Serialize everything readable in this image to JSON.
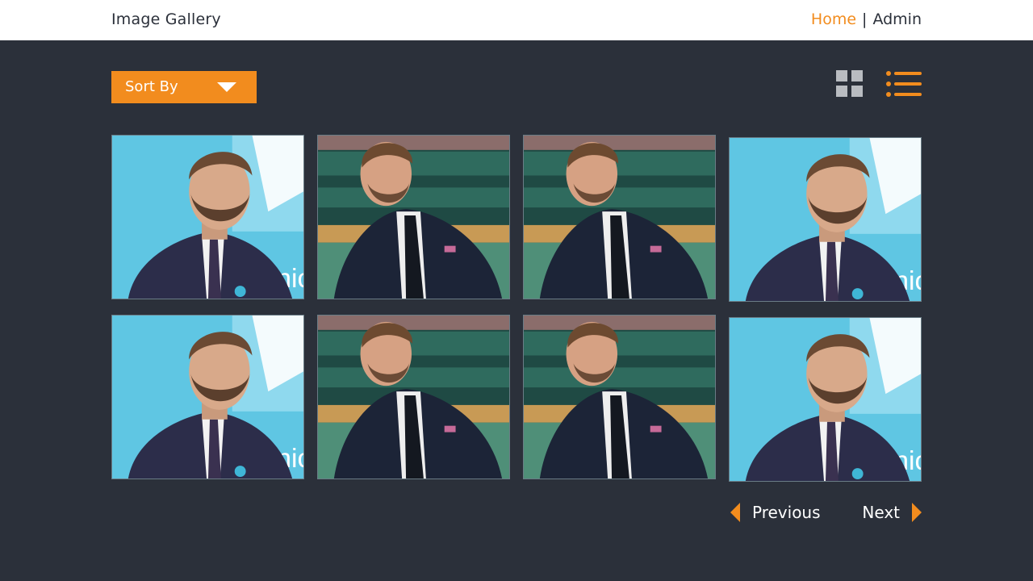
{
  "header": {
    "title": "Image Gallery",
    "nav": {
      "home": "Home",
      "separator": "|",
      "admin": "Admin"
    }
  },
  "toolbar": {
    "sort_label": "Sort By",
    "grid_view_icon": "grid-icon",
    "list_view_icon": "list-icon"
  },
  "gallery": {
    "images": [
      {
        "icon": "photo-portrait-blue",
        "variant": "blue"
      },
      {
        "icon": "photo-portrait-green",
        "variant": "green"
      },
      {
        "icon": "photo-portrait-green",
        "variant": "green"
      },
      {
        "icon": "photo-portrait-blue",
        "variant": "blue"
      },
      {
        "icon": "photo-portrait-blue",
        "variant": "blue"
      },
      {
        "icon": "photo-portrait-green",
        "variant": "green"
      },
      {
        "icon": "photo-portrait-green",
        "variant": "green"
      },
      {
        "icon": "photo-portrait-blue",
        "variant": "blue"
      }
    ]
  },
  "pagination": {
    "previous": "Previous",
    "next": "Next"
  },
  "colors": {
    "accent": "#f28c1e",
    "background": "#2b303a",
    "header": "#ffffff",
    "muted_icon": "#b9bcc1"
  }
}
